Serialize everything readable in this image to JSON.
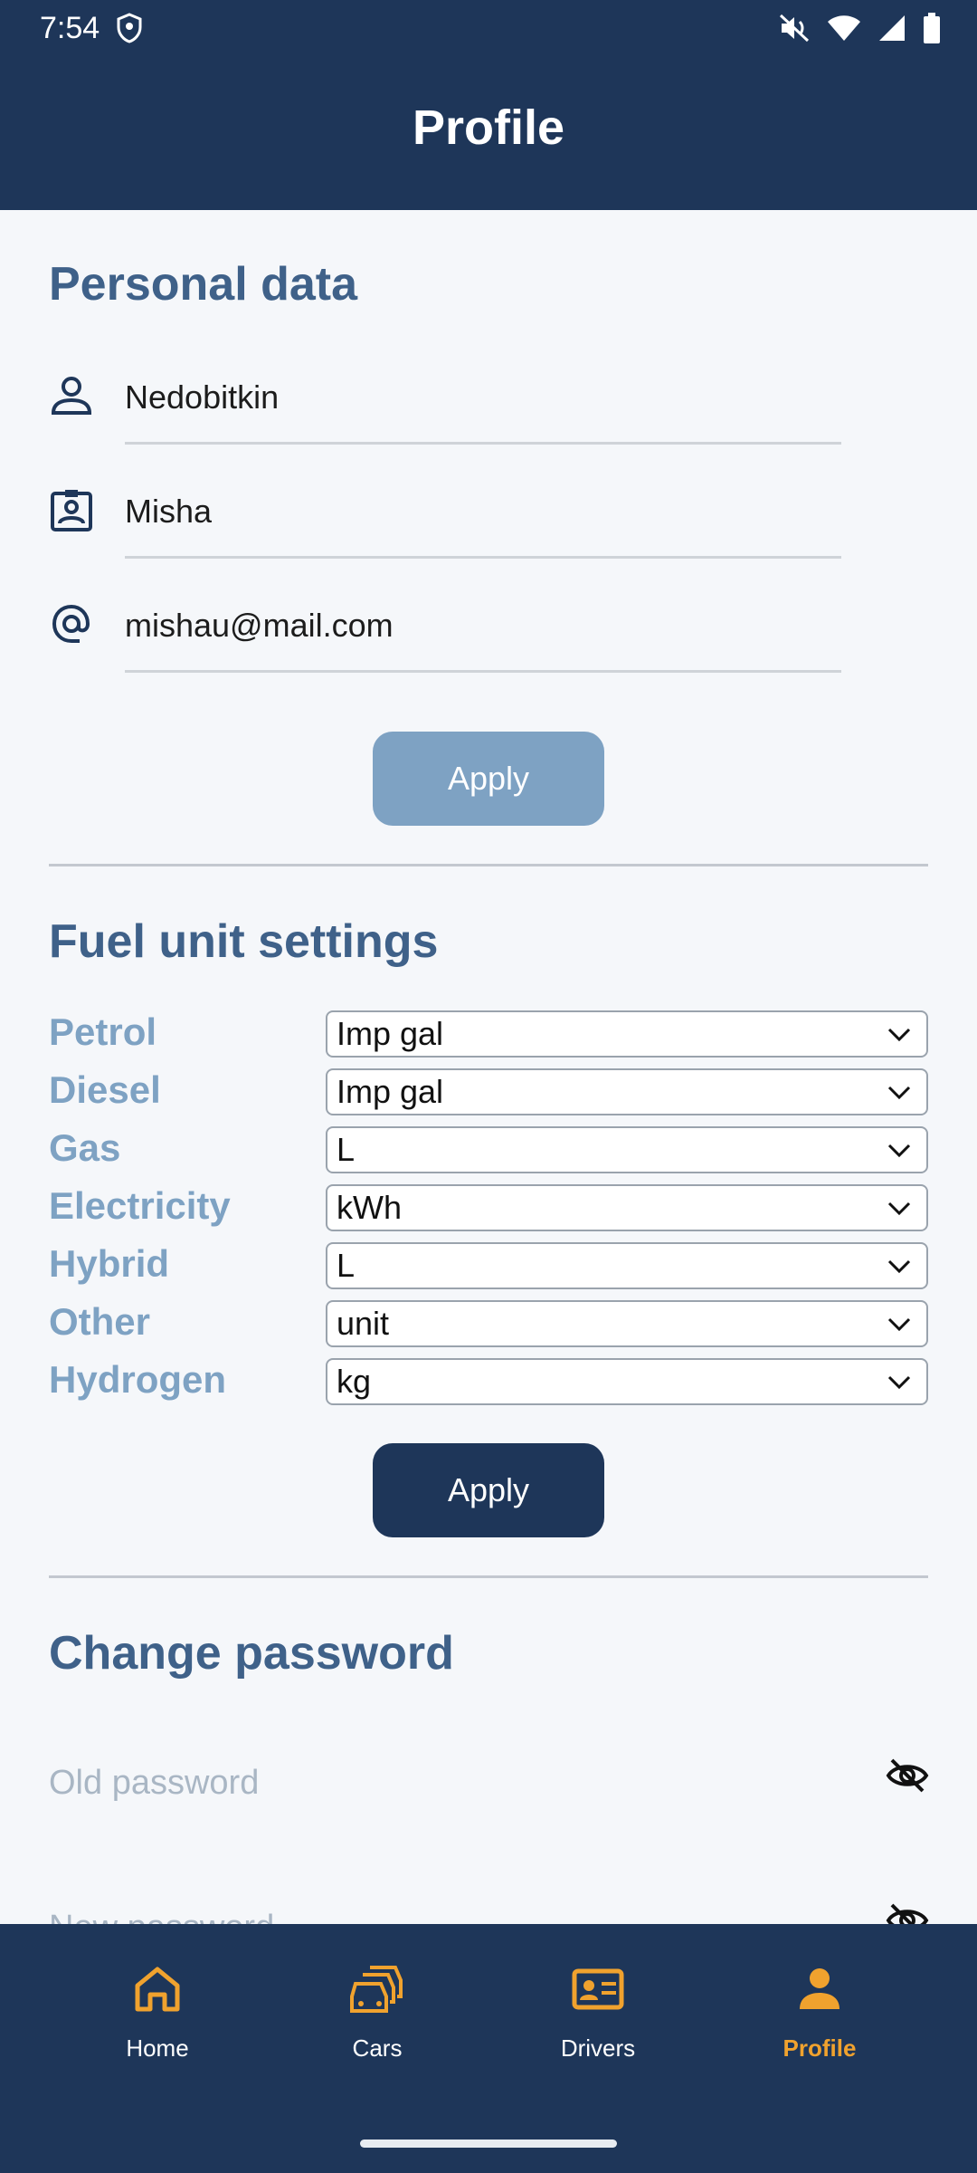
{
  "status_bar": {
    "time": "7:54"
  },
  "app_bar": {
    "title": "Profile"
  },
  "personal": {
    "title": "Personal data",
    "last_name": "Nedobitkin",
    "first_name": "Misha",
    "email": "mishau@mail.com",
    "apply_label": "Apply"
  },
  "fuel": {
    "title": "Fuel unit settings",
    "rows": [
      {
        "label": "Petrol",
        "value": "Imp gal"
      },
      {
        "label": "Diesel",
        "value": "Imp gal"
      },
      {
        "label": "Gas",
        "value": "L"
      },
      {
        "label": "Electricity",
        "value": "kWh"
      },
      {
        "label": "Hybrid",
        "value": "L"
      },
      {
        "label": "Other",
        "value": "unit"
      },
      {
        "label": "Hydrogen",
        "value": "kg"
      }
    ],
    "apply_label": "Apply"
  },
  "password": {
    "title": "Change password",
    "old_placeholder": "Old password",
    "new_placeholder": "New password"
  },
  "nav": {
    "items": [
      {
        "label": "Home",
        "icon": "home-icon"
      },
      {
        "label": "Cars",
        "icon": "cars-icon"
      },
      {
        "label": "Drivers",
        "icon": "drivers-icon"
      },
      {
        "label": "Profile",
        "icon": "profile-icon"
      }
    ],
    "active": "Profile"
  },
  "colors": {
    "primary": "#1e3659",
    "section_title": "#3f6189",
    "fuel_label": "#7ea2c3",
    "accent": "#f0a22e"
  }
}
